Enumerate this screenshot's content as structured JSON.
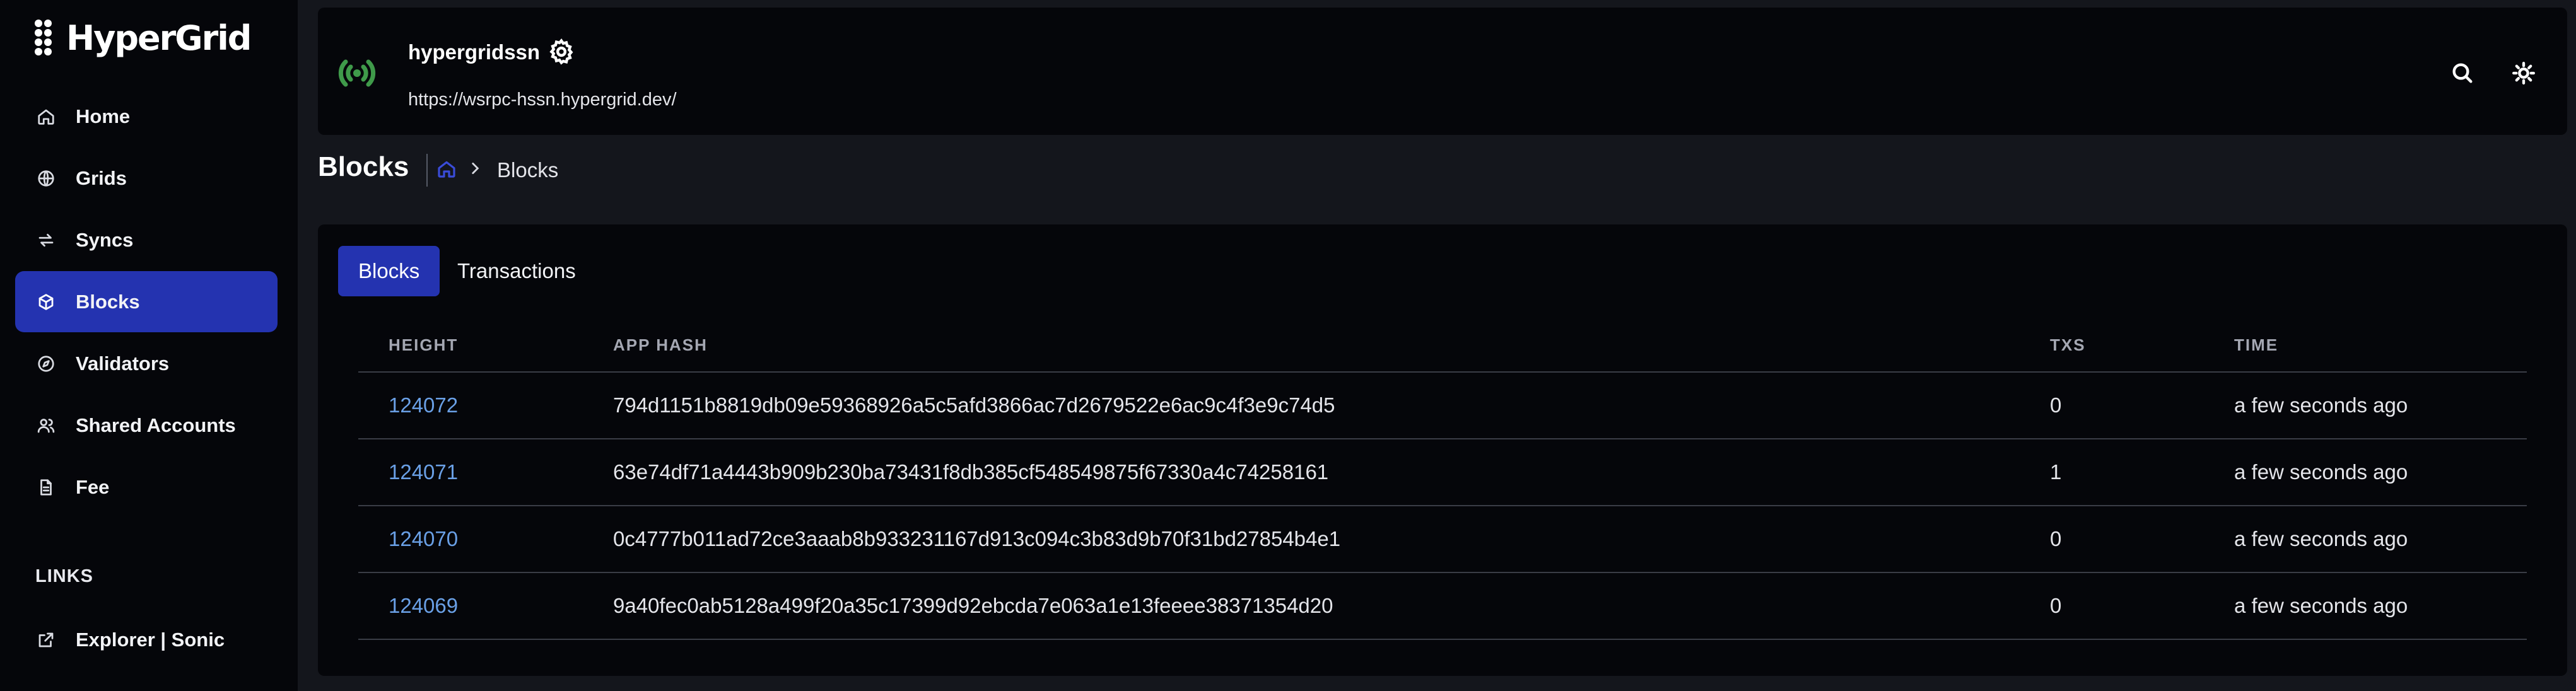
{
  "app": {
    "name": "HyperGrid"
  },
  "sidebar": {
    "items": [
      {
        "label": "Home",
        "icon": "home-icon"
      },
      {
        "label": "Grids",
        "icon": "globe-icon"
      },
      {
        "label": "Syncs",
        "icon": "sync-icon"
      },
      {
        "label": "Blocks",
        "icon": "cube-icon",
        "active": true
      },
      {
        "label": "Validators",
        "icon": "compass-icon"
      },
      {
        "label": "Shared Accounts",
        "icon": "users-icon"
      },
      {
        "label": "Fee",
        "icon": "document-icon"
      }
    ],
    "links_heading": "LINKS",
    "links": [
      {
        "label": "Explorer | Sonic",
        "icon": "external-link-icon"
      }
    ]
  },
  "header": {
    "chain_name": "hypergridssn",
    "rpc_url": "https://wsrpc-hssn.hypergrid.dev/",
    "status_color": "#3f9a4a"
  },
  "page": {
    "title": "Blocks",
    "breadcrumb": [
      "home-icon",
      "Blocks"
    ]
  },
  "tabs": [
    {
      "label": "Blocks",
      "active": true
    },
    {
      "label": "Transactions",
      "active": false
    }
  ],
  "table": {
    "columns": [
      "HEIGHT",
      "APP HASH",
      "TXS",
      "TIME"
    ],
    "rows": [
      {
        "height": "124072",
        "hash": "794d1151b8819db09e59368926a5c5afd3866ac7d2679522e6ac9c4f3e9c74d5",
        "txs": "0",
        "time": "a few seconds ago"
      },
      {
        "height": "124071",
        "hash": "63e74df71a4443b909b230ba73431f8db385cf548549875f67330a4c74258161",
        "txs": "1",
        "time": "a few seconds ago"
      },
      {
        "height": "124070",
        "hash": "0c4777b011ad72ce3aaab8b933231167d913c094c3b83d9b70f31bd27854b4e1",
        "txs": "0",
        "time": "a few seconds ago"
      },
      {
        "height": "124069",
        "hash": "9a40fec0ab5128a499f20a35c17399d92ebcda7e063a1e13feeee38371354d20",
        "txs": "0",
        "time": "a few seconds ago"
      }
    ]
  },
  "colors": {
    "accent": "#2433b0",
    "link": "#6aa0e6",
    "background": "#14161c",
    "panel": "#05060a"
  }
}
